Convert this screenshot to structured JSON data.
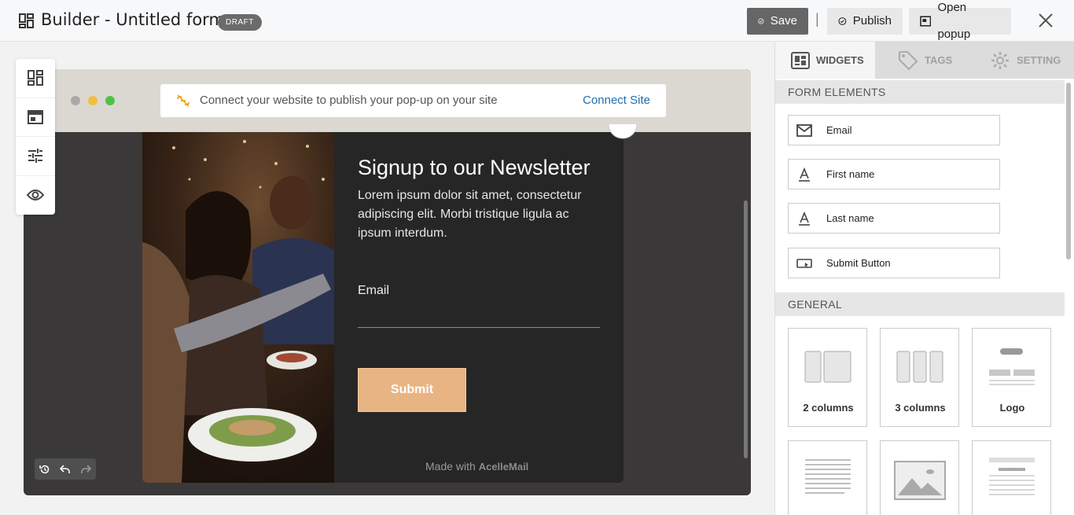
{
  "header": {
    "title": "Builder - Untitled form",
    "status_badge": "DRAFT",
    "save_label": "Save",
    "separator": "|",
    "publish_label": "Publish",
    "open_popup_label": "Open popup"
  },
  "browser": {
    "connect_message": "Connect your website to publish your pop-up on your site",
    "connect_link": "Connect Site"
  },
  "popup": {
    "title": "Signup to our Newsletter",
    "description": "Lorem ipsum dolor sit amet, consectetur adipiscing elit. Morbi tristique ligula ac ipsum interdum.",
    "email_label": "Email",
    "submit_label": "Submit",
    "made_with": "Made with",
    "brand": "AcelleMail"
  },
  "panel": {
    "tabs": [
      {
        "label": "WIDGETS",
        "icon": "widgets-icon",
        "active": true
      },
      {
        "label": "TAGS",
        "icon": "tag-icon",
        "active": false
      },
      {
        "label": "SETTING",
        "icon": "gear-icon",
        "active": false
      }
    ],
    "form_elements_title": "FORM ELEMENTS",
    "form_elements": [
      {
        "label": "Email",
        "icon": "envelope-icon"
      },
      {
        "label": "First name",
        "icon": "text-icon"
      },
      {
        "label": "Last name",
        "icon": "text-icon"
      },
      {
        "label": "Submit Button",
        "icon": "button-icon"
      }
    ],
    "general_title": "GENERAL",
    "general": [
      {
        "label": "2 columns",
        "icon": "two-columns-icon"
      },
      {
        "label": "3 columns",
        "icon": "three-columns-icon"
      },
      {
        "label": "Logo",
        "icon": "logo-icon"
      },
      {
        "label": "",
        "icon": "text-block-icon"
      },
      {
        "label": "",
        "icon": "image-icon"
      },
      {
        "label": "",
        "icon": "heading-text-icon"
      }
    ]
  },
  "colors": {
    "accent_link": "#1f6fb0",
    "submit_button": "#e9b483",
    "popup_background": "#262626"
  }
}
